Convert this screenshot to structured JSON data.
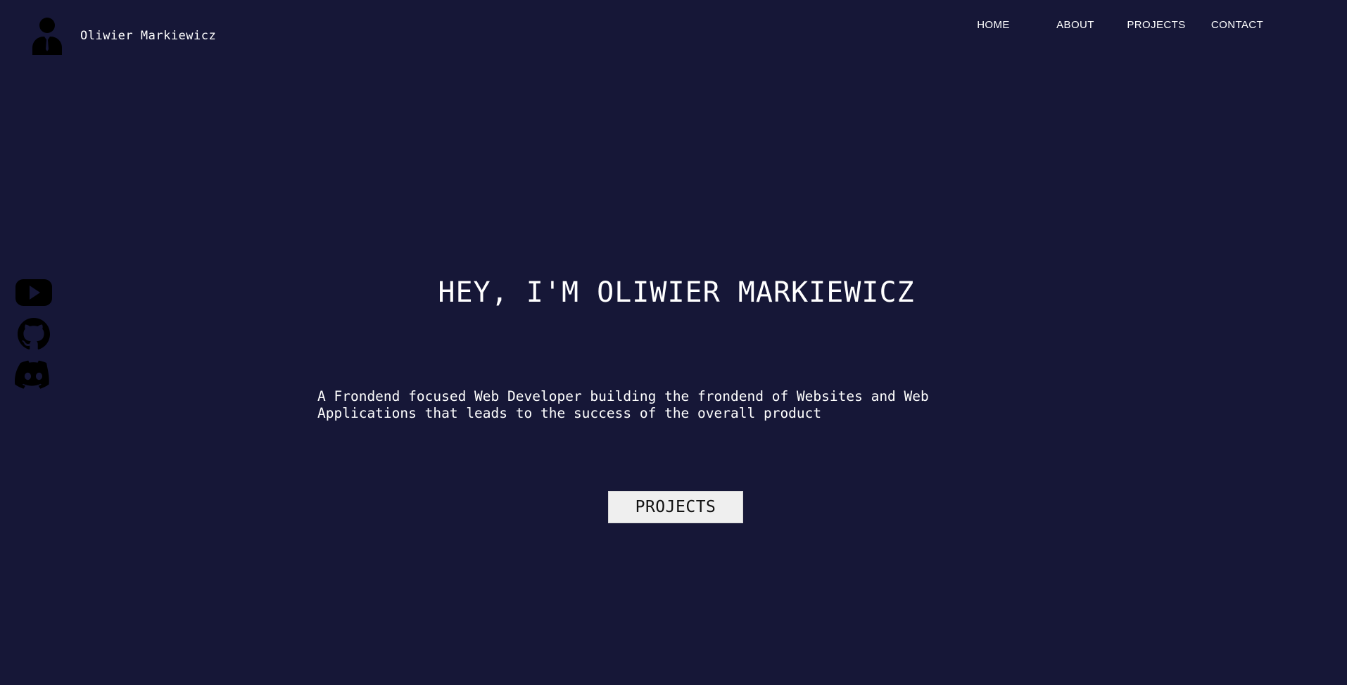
{
  "header": {
    "brand_name": "Oliwier Markiewicz",
    "nav": [
      {
        "label": "HOME"
      },
      {
        "label": "ABOUT"
      },
      {
        "label": "PROJECTS"
      },
      {
        "label": "CONTACT"
      }
    ]
  },
  "social": [
    {
      "icon": "youtube-icon"
    },
    {
      "icon": "github-icon"
    },
    {
      "icon": "discord-icon"
    }
  ],
  "hero": {
    "title": "HEY, I'M OLIWIER MARKIEWICZ",
    "subtitle": "A Frondend focused Web Developer building the frondend of Websites and Web Applications that leads to the success of the overall product",
    "button_label": "PROJECTS"
  },
  "colors": {
    "background": "#161737",
    "text": "#ffffff",
    "button_bg": "#efefef",
    "icon": "#000000"
  }
}
